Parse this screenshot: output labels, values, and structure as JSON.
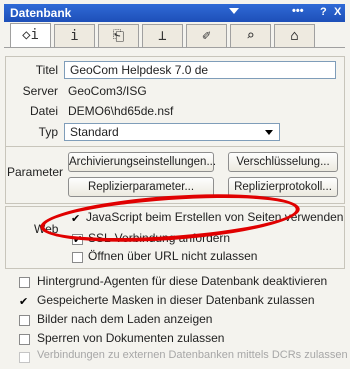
{
  "window": {
    "title": "Datenbank",
    "help": "?",
    "close": "X",
    "dots": "•••"
  },
  "tabs": [
    {
      "icon": "info-general-icon",
      "glyph": "◇i",
      "active": true
    },
    {
      "icon": "info-icon",
      "glyph": "i"
    },
    {
      "icon": "printer-icon",
      "glyph": "⎗"
    },
    {
      "icon": "design-icon",
      "glyph": "⊥"
    },
    {
      "icon": "pen-icon",
      "glyph": "✐"
    },
    {
      "icon": "search-icon",
      "glyph": "⌕"
    },
    {
      "icon": "hat-icon",
      "glyph": "⌂"
    }
  ],
  "info": {
    "titel_label": "Titel",
    "titel_value": "GeoCom Helpdesk 7.0 de",
    "server_label": "Server",
    "server_value": "GeoCom3/ISG",
    "datei_label": "Datei",
    "datei_value": "DEMO6\\hd65de.nsf",
    "typ_label": "Typ",
    "typ_value": "Standard"
  },
  "parameter": {
    "label": "Parameter",
    "archiv": "Archivierungseinstellungen...",
    "verschl": "Verschlüsselung...",
    "replparam": "Replizierparameter...",
    "replprot": "Replizierprotokoll..."
  },
  "web": {
    "label": "Web",
    "items": [
      {
        "label": "JavaScript beim Erstellen von Seiten verwenden",
        "checked": true
      },
      {
        "label": "SSL-Verbindung anfordern",
        "checked": true
      },
      {
        "label": "Öffnen über URL nicht zulassen",
        "checked": false
      }
    ]
  },
  "options": [
    {
      "label": "Hintergrund-Agenten für diese Datenbank deaktivieren",
      "checked": false,
      "disabled": false
    },
    {
      "label": "Gespeicherte Masken in dieser Datenbank zulassen",
      "checked": true,
      "disabled": false
    },
    {
      "label": "Bilder nach dem Laden anzeigen",
      "checked": false,
      "disabled": false
    },
    {
      "label": "Sperren von Dokumenten zulassen",
      "checked": false,
      "disabled": false
    },
    {
      "label": "Verbindungen zu externen Datenbanken mittels DCRs zulassen",
      "checked": false,
      "disabled": true
    }
  ],
  "colors": {
    "titlebar": "#2f6ad6",
    "annotation": "#e00000"
  }
}
